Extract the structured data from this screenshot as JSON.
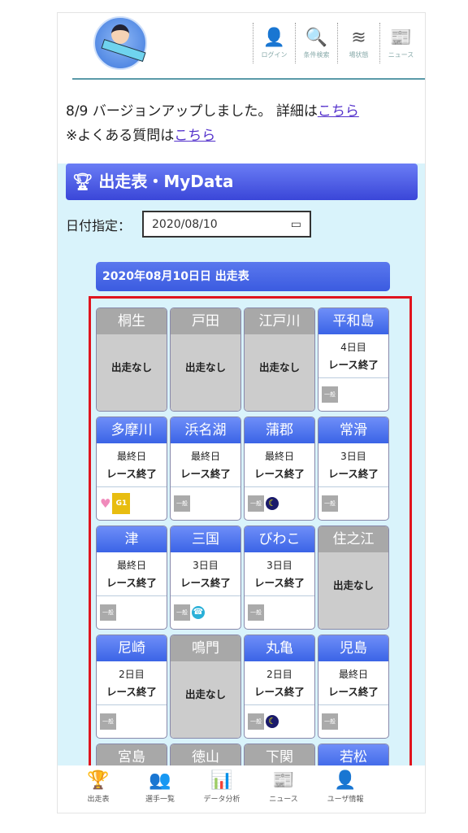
{
  "header": {
    "nav": [
      {
        "label": "ログイン",
        "icon": "user-icon",
        "glyph": "👤"
      },
      {
        "label": "条件検索",
        "icon": "search-icon",
        "glyph": "🔍"
      },
      {
        "label": "場状態",
        "icon": "waves-icon",
        "glyph": "≋"
      },
      {
        "label": "ニュース",
        "icon": "newspaper-icon",
        "glyph": "📰"
      }
    ]
  },
  "notice": {
    "line1": "8/9 バージョンアップしました。 詳細は",
    "link1": "こちら",
    "line2": "※よくある質問は",
    "link2": "こちら"
  },
  "section": {
    "title": "出走表・MyData",
    "date_label": "日付指定：",
    "date_value": "2020/08/10",
    "subheader": "2020年08月10日日 出走表"
  },
  "venues": [
    {
      "name": "桐生",
      "none": "出走なし"
    },
    {
      "name": "戸田",
      "none": "出走なし"
    },
    {
      "name": "江戸川",
      "none": "出走なし"
    },
    {
      "name": "平和島",
      "day": "4日目",
      "status": "レース終了",
      "grade": "一般"
    },
    {
      "name": "多摩川",
      "day": "最終日",
      "status": "レース終了",
      "grade": "G1",
      "heart": true
    },
    {
      "name": "浜名湖",
      "day": "最終日",
      "status": "レース終了",
      "grade": "一般"
    },
    {
      "name": "蒲郡",
      "day": "最終日",
      "status": "レース終了",
      "grade": "一般",
      "night": true
    },
    {
      "name": "常滑",
      "day": "3日目",
      "status": "レース終了",
      "grade": "一般"
    },
    {
      "name": "津",
      "day": "最終日",
      "status": "レース終了",
      "grade": "一般"
    },
    {
      "name": "三国",
      "day": "3日目",
      "status": "レース終了",
      "grade": "一般",
      "tel": true
    },
    {
      "name": "びわこ",
      "day": "3日目",
      "status": "レース終了",
      "grade": "一般"
    },
    {
      "name": "住之江",
      "none": "出走なし"
    },
    {
      "name": "尼崎",
      "day": "2日目",
      "status": "レース終了",
      "grade": "一般"
    },
    {
      "name": "鳴門",
      "none": "出走なし"
    },
    {
      "name": "丸亀",
      "day": "2日目",
      "status": "レース終了",
      "grade": "一般",
      "night": true
    },
    {
      "name": "児島",
      "day": "最終日",
      "status": "レース終了",
      "grade": "一般"
    },
    {
      "name": "宮島",
      "none": ""
    },
    {
      "name": "徳山",
      "none": ""
    },
    {
      "name": "下関",
      "none": ""
    },
    {
      "name": "若松",
      "day": "",
      "status": "",
      "grade": ""
    }
  ],
  "bottom_nav": [
    {
      "label": "出走表",
      "icon": "trophy-icon",
      "glyph": "🏆"
    },
    {
      "label": "選手一覧",
      "icon": "players-icon",
      "glyph": "👥"
    },
    {
      "label": "データ分析",
      "icon": "chart-icon",
      "glyph": "📊"
    },
    {
      "label": "ニュース",
      "icon": "newspaper-icon",
      "glyph": "📰"
    },
    {
      "label": "ユーザ情報",
      "icon": "user-icon",
      "glyph": "👤"
    }
  ]
}
